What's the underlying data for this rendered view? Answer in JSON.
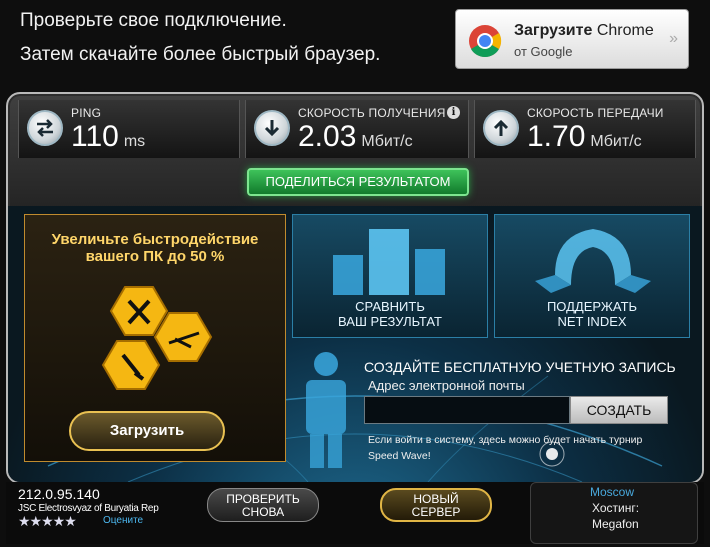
{
  "promo": {
    "line1": "Проверьте свое подключение.",
    "line2": "Затем скачайте более быстрый браузер."
  },
  "chrome_button": {
    "title_bold": "Загрузите",
    "title_rest": "Chrome",
    "subtitle": "от Google",
    "arrow": "»"
  },
  "stats": {
    "ping": {
      "label": "PING",
      "value": "110",
      "unit": "ms"
    },
    "download": {
      "label": "СКОРОСТЬ ПОЛУЧЕНИЯ",
      "value": "2.03",
      "unit": "Мбит/с"
    },
    "upload": {
      "label": "СКОРОСТЬ ПЕРЕДАЧИ",
      "value": "1.70",
      "unit": "Мбит/с"
    }
  },
  "share_button": "ПОДЕЛИТЬСЯ РЕЗУЛЬТАТОМ",
  "ad": {
    "headline_line1": "Увеличьте быстродействие",
    "headline_line2": "вашего ПК до 50 %",
    "download_button": "Загрузить"
  },
  "tiles": {
    "compare_line1": "СРАВНИТЬ",
    "compare_line2": "ВАШ РЕЗУЛЬТАТ",
    "support_line1": "ПОДДЕРЖАТЬ",
    "support_line2": "NET INDEX"
  },
  "account": {
    "title": "СОЗДАЙТЕ БЕСПЛАТНУЮ УЧЕТНУЮ ЗАПИСЬ",
    "email_label": "Адрес электронной почты",
    "email_value": "",
    "create_button": "СОЗДАТЬ",
    "note": "Если войти в систему, здесь можно будет начать турнир Speed Wave!"
  },
  "server": {
    "ip": "212.0.95.140",
    "isp": "JSC Electrosvyaz of Buryatia Rep",
    "stars": "★★★★★",
    "rate_link": "Оцените"
  },
  "buttons": {
    "retest_line1": "ПРОВЕРИТЬ",
    "retest_line2": "СНОВА",
    "new_server_line1": "НОВЫЙ",
    "new_server_line2": "СЕРВЕР"
  },
  "host": {
    "city": "Moscow",
    "label": "Хостинг:",
    "name": "Megafon"
  },
  "colors": {
    "accent_green": "#3ec25a",
    "accent_gold": "#e9c152",
    "link_blue": "#4cb8f0"
  }
}
